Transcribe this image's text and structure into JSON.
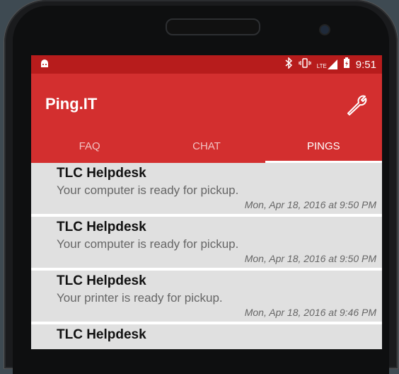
{
  "status_bar": {
    "time": "9:51",
    "lte_label": "LTE",
    "icons": [
      "android-icon",
      "bluetooth-icon",
      "vibrate-icon",
      "signal-icon",
      "battery-icon"
    ]
  },
  "app_bar": {
    "title": "Ping.IT",
    "settings_icon": "wrench-icon"
  },
  "tabs": [
    {
      "label": "FAQ",
      "active": false
    },
    {
      "label": "CHAT",
      "active": false
    },
    {
      "label": "PINGS",
      "active": true
    }
  ],
  "pings": [
    {
      "sender": "TLC Helpdesk",
      "message": "Your computer is ready for pickup.",
      "time": "Mon, Apr 18, 2016 at 9:50 PM"
    },
    {
      "sender": "TLC Helpdesk",
      "message": "Your computer is ready for pickup.",
      "time": "Mon, Apr 18, 2016 at 9:50 PM"
    },
    {
      "sender": "TLC Helpdesk",
      "message": "Your printer is ready for pickup.",
      "time": "Mon, Apr 18, 2016 at 9:46 PM"
    },
    {
      "sender": "TLC Helpdesk",
      "message": "",
      "time": ""
    }
  ],
  "colors": {
    "status_bar": "#b71c1c",
    "app_bar": "#d32f2f",
    "list_bg": "#e0e0e0"
  }
}
